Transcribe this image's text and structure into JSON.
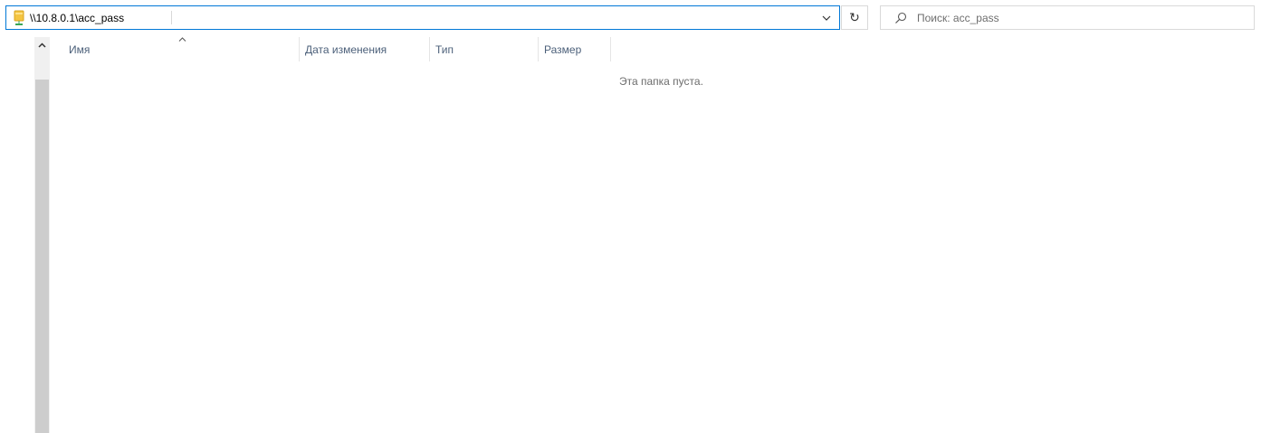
{
  "address_bar": {
    "path": "\\\\10.8.0.1\\acc_pass",
    "folder_icon": "network-folder-icon",
    "dropdown_icon": "chevron-down-icon"
  },
  "refresh": {
    "icon": "refresh-icon",
    "glyph": "↻"
  },
  "search": {
    "placeholder": "Поиск: acc_pass",
    "icon": "search-icon"
  },
  "columns": [
    {
      "label": "Имя"
    },
    {
      "label": "Дата изменения"
    },
    {
      "label": "Тип"
    },
    {
      "label": "Размер"
    }
  ],
  "file_list": {
    "empty_message": "Эта папка пуста."
  },
  "colors": {
    "accent": "#0078d7",
    "header_text": "#4c607a",
    "muted_text": "#6d6d6d",
    "scrollbar_thumb": "#cdcdcd"
  }
}
